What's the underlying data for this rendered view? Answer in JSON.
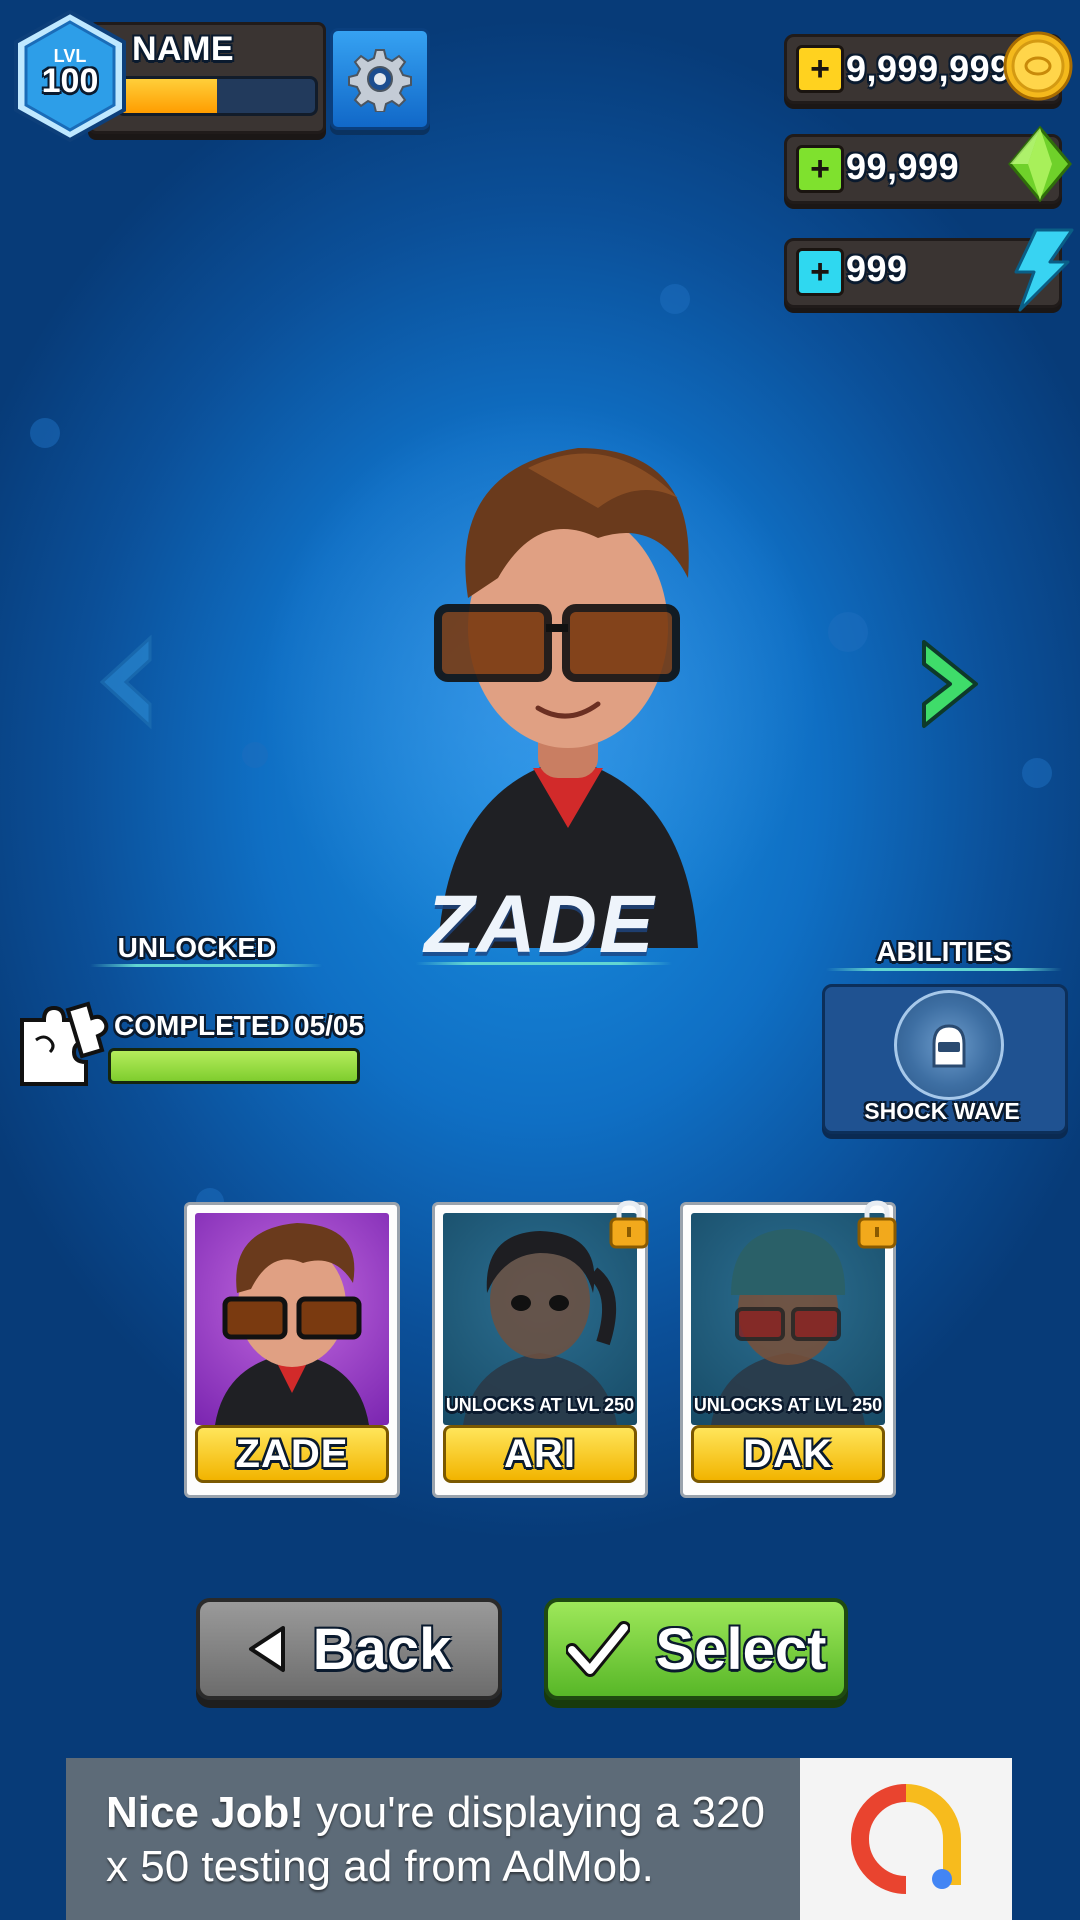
{
  "player": {
    "level_label": "LVL",
    "level": "100",
    "name": "NAME",
    "xp_progress": 0.5
  },
  "settings": {
    "icon": "gear-icon"
  },
  "currencies": [
    {
      "value": "9,999,999",
      "icon": "gold-coin-icon",
      "plus_color": "#ffd21f"
    },
    {
      "value": "99,999",
      "icon": "green-gem-icon",
      "plus_color": "#7fe12e"
    },
    {
      "value": "999",
      "icon": "lightning-energy-icon",
      "plus_color": "#2fd8f0"
    }
  ],
  "character": {
    "name": "ZADE",
    "prev_icon": "chevron-left-icon",
    "next_icon": "chevron-right-icon"
  },
  "status": {
    "unlocked_label": "UNLOCKED",
    "completed_label": "COMPLETED",
    "completed_count": "05/05",
    "completed_progress": 1.0,
    "icon": "puzzle-pieces-icon"
  },
  "abilities": {
    "label": "ABILITIES",
    "ability_name": "SHOCK WAVE",
    "icon": "shock-wave-icon"
  },
  "cards": [
    {
      "name": "ZADE",
      "locked": false,
      "note": ""
    },
    {
      "name": "ARI",
      "locked": true,
      "note": "UNLOCKS AT LVL 250"
    },
    {
      "name": "DAK",
      "locked": true,
      "note": "UNLOCKS AT LVL 250"
    }
  ],
  "buttons": {
    "back_label": "Back",
    "select_label": "Select"
  },
  "ad": {
    "bold": "Nice Job!",
    "text": " you're displaying a 320 x 50 testing ad from AdMob."
  },
  "colors": {
    "background": "#0f6fc4",
    "accent_green": "#7fcd2e",
    "accent_yellow": "#f2b400"
  }
}
